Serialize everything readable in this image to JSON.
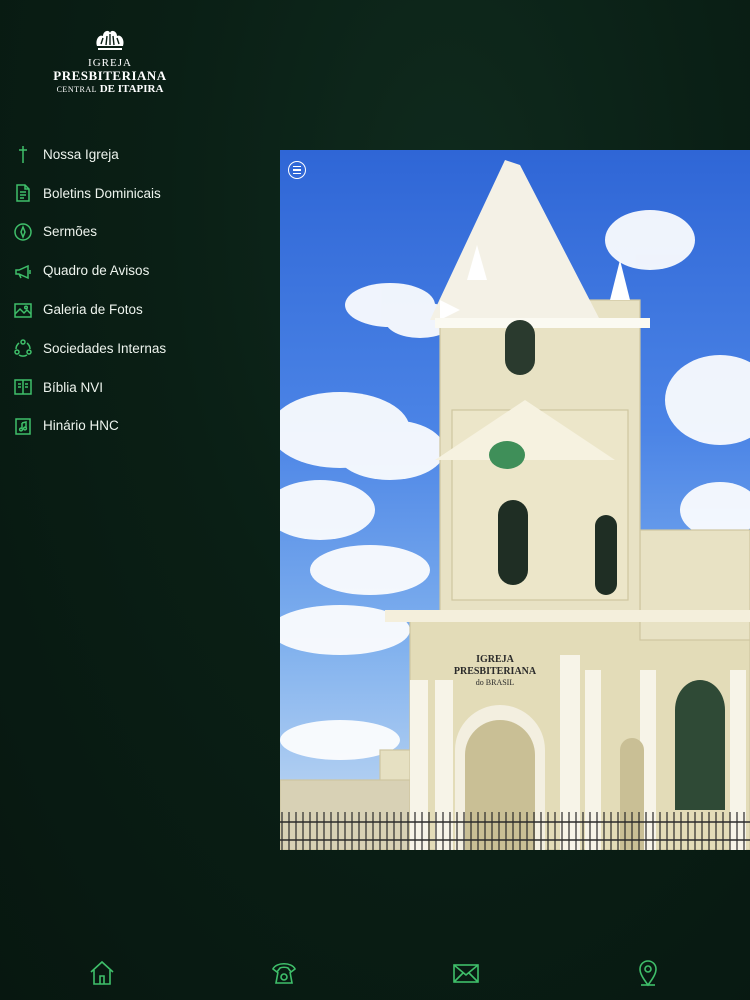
{
  "logo": {
    "line1": "IGREJA",
    "line2": "PRESBITERIANA",
    "line3_small": "CENTRAL",
    "line3_main": "DE ITAPIRA"
  },
  "menu": {
    "items": [
      {
        "label": "Nossa Igreja",
        "icon": "cross-icon"
      },
      {
        "label": "Boletins Dominicais",
        "icon": "document-icon"
      },
      {
        "label": "Sermões",
        "icon": "compass-icon"
      },
      {
        "label": "Quadro de Avisos",
        "icon": "megaphone-icon"
      },
      {
        "label": "Galeria de Fotos",
        "icon": "photo-gallery-icon"
      },
      {
        "label": "Sociedades Internas",
        "icon": "people-circle-icon"
      },
      {
        "label": "Bíblia NVI",
        "icon": "bible-icon"
      },
      {
        "label": "Hinário HNC",
        "icon": "hymnal-icon"
      }
    ]
  },
  "hero": {
    "sign_line1": "IGREJA",
    "sign_line2": "PRESBITERIANA",
    "sign_line3": "do BRASIL"
  },
  "bottom_nav": [
    "home-icon",
    "phone-icon",
    "mail-icon",
    "location-icon"
  ],
  "colors": {
    "background": "#0a1f15",
    "accent": "#3fbf6a",
    "text": "#eef4ee"
  }
}
